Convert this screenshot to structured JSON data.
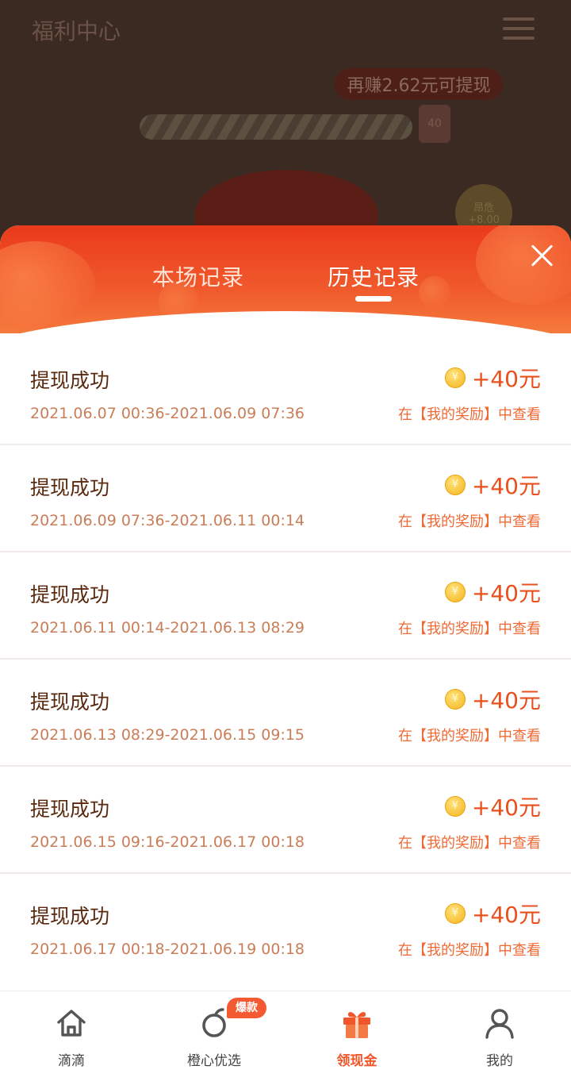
{
  "background": {
    "title": "福利中心",
    "earn_tip": "再赚2.62元可提现",
    "progress_badge": "40",
    "coin_circle": [
      "昂危",
      "+8.00"
    ]
  },
  "sheet": {
    "tabs": [
      {
        "label": "本场记录",
        "active": false
      },
      {
        "label": "历史记录",
        "active": true
      }
    ],
    "records": [
      {
        "title": "提现成功",
        "time": "2021.06.07 00:36-2021.06.09 07:36",
        "amount": "+40元",
        "hint": "在【我的奖励】中查看"
      },
      {
        "title": "提现成功",
        "time": "2021.06.09 07:36-2021.06.11 00:14",
        "amount": "+40元",
        "hint": "在【我的奖励】中查看"
      },
      {
        "title": "提现成功",
        "time": "2021.06.11 00:14-2021.06.13 08:29",
        "amount": "+40元",
        "hint": "在【我的奖励】中查看"
      },
      {
        "title": "提现成功",
        "time": "2021.06.13 08:29-2021.06.15 09:15",
        "amount": "+40元",
        "hint": "在【我的奖励】中查看"
      },
      {
        "title": "提现成功",
        "time": "2021.06.15 09:16-2021.06.17 00:18",
        "amount": "+40元",
        "hint": "在【我的奖励】中查看"
      },
      {
        "title": "提现成功",
        "time": "2021.06.17 00:18-2021.06.19 00:18",
        "amount": "+40元",
        "hint": "在【我的奖励】中查看"
      }
    ],
    "coin_symbol": "¥"
  },
  "nav": {
    "items": [
      {
        "label": "滴滴",
        "icon": "home-icon",
        "active": false
      },
      {
        "label": "橙心优选",
        "icon": "orange-icon",
        "active": false,
        "badge": "爆款"
      },
      {
        "label": "领现金",
        "icon": "gift-icon",
        "active": true
      },
      {
        "label": "我的",
        "icon": "person-icon",
        "active": false
      }
    ]
  },
  "colors": {
    "accent": "#f0562a",
    "header_red": "#ea3a1c",
    "record_title": "#5a2a10",
    "record_time": "#c97e5a",
    "amount": "#e8501e"
  }
}
